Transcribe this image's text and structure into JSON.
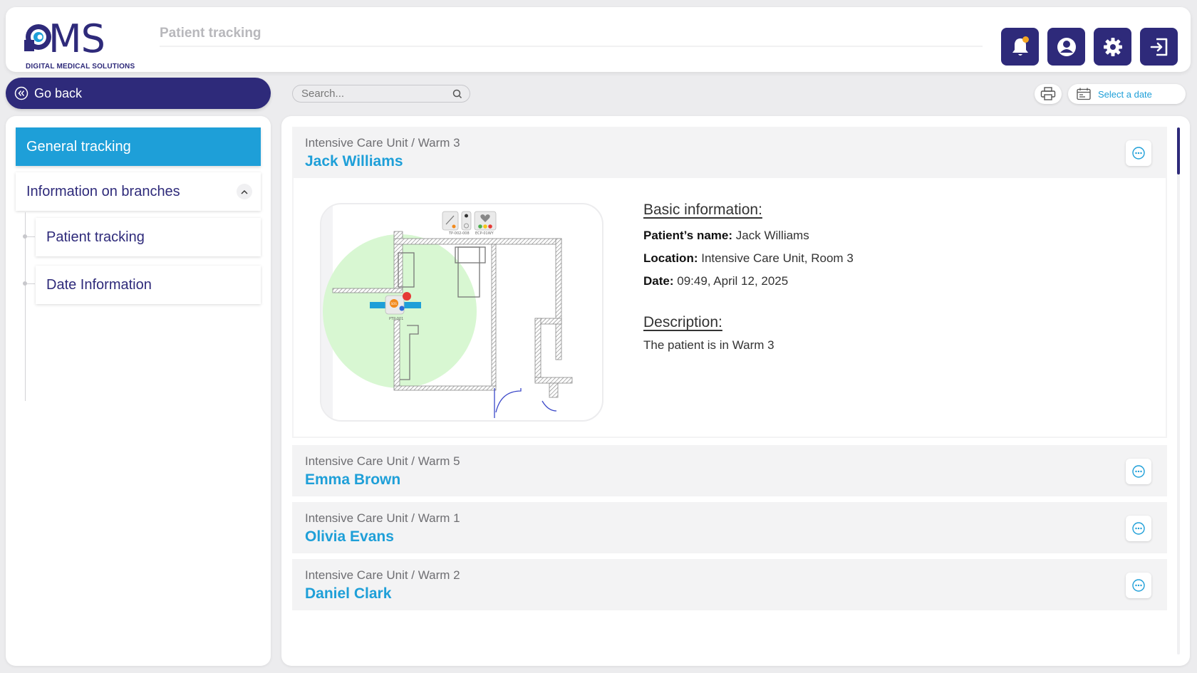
{
  "brand": {
    "name": "MS",
    "tagline": "DIGITAL MEDICAL SOLUTIONS"
  },
  "header": {
    "title": "Patient tracking",
    "actions": [
      "bell-icon",
      "user-icon",
      "gear-icon",
      "logout-icon"
    ]
  },
  "toolbar": {
    "back_label": "Go back",
    "search_placeholder": "Search...",
    "date_label": "Select a date"
  },
  "sidebar": {
    "general": "General tracking",
    "branches": "Information on branches",
    "sub_items": [
      "Patient tracking",
      "Date Information"
    ]
  },
  "patients": [
    {
      "location": "Intensive Care Unit / Warm 3",
      "name": "Jack Williams",
      "expanded": true,
      "details": {
        "basic_title": "Basic information:",
        "name_label": "Patient’s name:",
        "name_value": "Jack Williams",
        "location_label": "Location:",
        "location_value": "Intensive Care Unit, Room 3",
        "date_label": "Date:",
        "date_value": "09:49, April 12, 2025",
        "desc_title": "Description:",
        "desc_value": "The patient is in Warm 3"
      },
      "map": {
        "device_labels": [
          "TP-002-008",
          "ECP-01WY",
          "PTP-001"
        ],
        "sos_label": "SOS"
      }
    },
    {
      "location": "Intensive Care Unit / Warm 5",
      "name": "Emma Brown"
    },
    {
      "location": "Intensive Care Unit / Warm 1",
      "name": "Olivia Evans"
    },
    {
      "location": "Intensive Care Unit / Warm 2",
      "name": "Daniel Clark"
    }
  ],
  "colors": {
    "primary": "#2e2a7a",
    "accent": "#1e9fd8",
    "notification": "#f5a623",
    "zone": "#d8f7d2"
  }
}
